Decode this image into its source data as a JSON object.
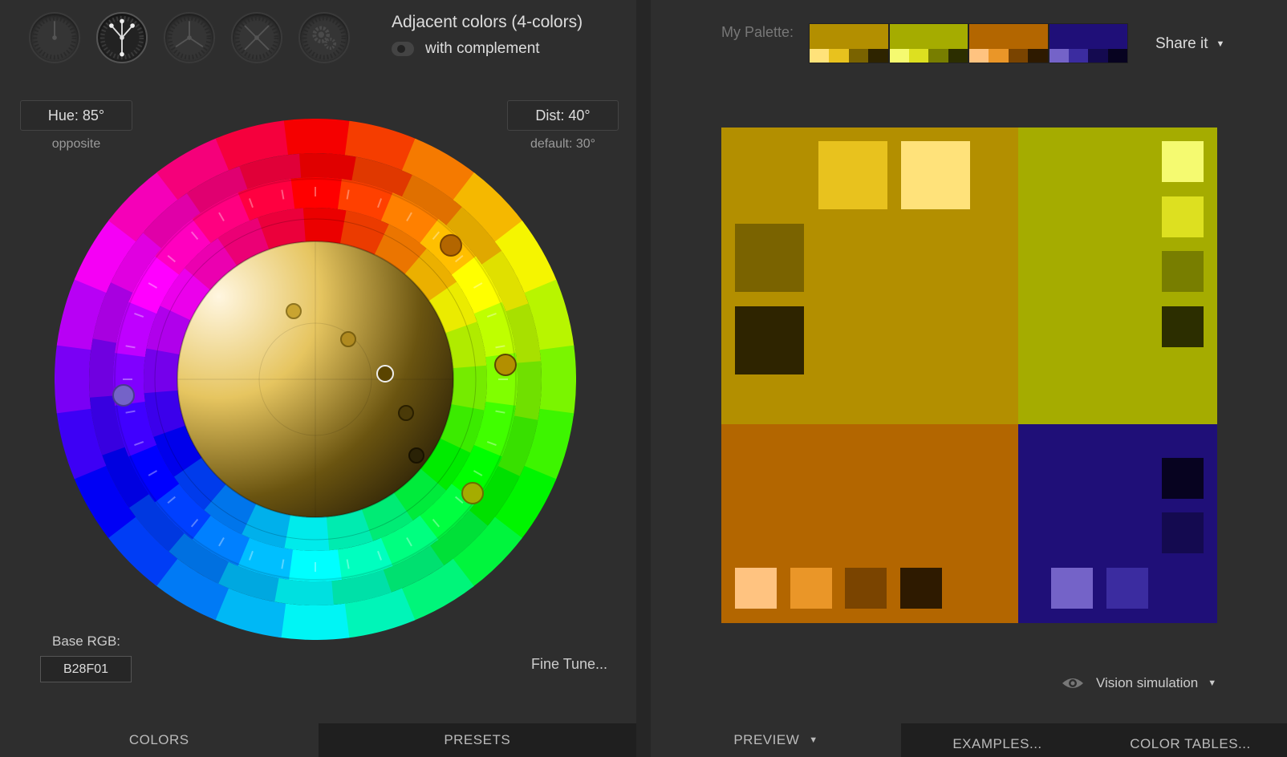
{
  "scheme": {
    "title": "Adjacent colors (4-colors)",
    "complement_label": "with complement",
    "complement_enabled": true,
    "buttons": [
      {
        "name": "mono"
      },
      {
        "name": "adjacent"
      },
      {
        "name": "triad"
      },
      {
        "name": "tetrad"
      },
      {
        "name": "freestyle"
      }
    ],
    "active_index": 1
  },
  "hue": {
    "label": "Hue: 85°",
    "sub": "opposite"
  },
  "dist": {
    "label": "Dist: 40°",
    "sub": "default: 30°"
  },
  "base_rgb": {
    "label": "Base RGB:",
    "value": "B28F01"
  },
  "fine_tune_label": "Fine Tune...",
  "left_tabs": [
    {
      "label": "COLORS",
      "active": true
    },
    {
      "label": "PRESETS",
      "active": false
    }
  ],
  "palette": {
    "label": "My Palette:",
    "colors": [
      {
        "main": "#b38f00",
        "shades": [
          "#ffe27a",
          "#e8c21e",
          "#7a6300",
          "#2e2400"
        ]
      },
      {
        "main": "#a5ac00",
        "shades": [
          "#f5fa70",
          "#dde020",
          "#787e00",
          "#2c2e00"
        ]
      },
      {
        "main": "#b36600",
        "shades": [
          "#ffc380",
          "#ea9628",
          "#7a4400",
          "#2e1a00"
        ]
      },
      {
        "main": "#1f0f78",
        "shades": [
          "#7463c8",
          "#3b2ca0",
          "#140a50",
          "#070320"
        ]
      }
    ]
  },
  "share_label": "Share it",
  "vision_label": "Vision simulation",
  "right_tabs": [
    {
      "label": "PREVIEW",
      "active": true,
      "caret": true
    },
    {
      "label": "EXAMPLES...",
      "active": false
    },
    {
      "label": "COLOR TABLES...",
      "active": false
    }
  ],
  "colors": {
    "primary": "#b38f00",
    "secondary_1": "#a5ac00",
    "secondary_2": "#b36600",
    "complement": "#1f0f78"
  }
}
